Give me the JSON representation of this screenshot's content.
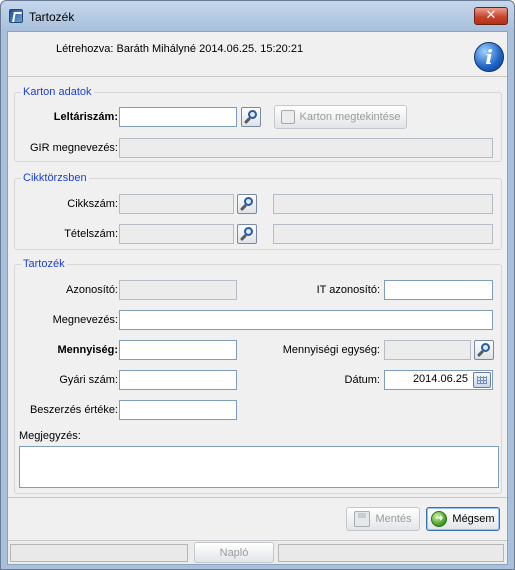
{
  "window": {
    "title": "Tartozék"
  },
  "header": {
    "created_by": "Létrehozva: Baráth Mihályné 2014.06.25. 15:20:21"
  },
  "karton": {
    "legend": "Karton adatok",
    "leltarszam_label": "Leltáriszám:",
    "leltarszam_value": "",
    "view_button": "Karton megtekintése",
    "gir_label": "GIR megnevezés:",
    "gir_value": ""
  },
  "cikk": {
    "legend": "Cikktörzsben",
    "cikkszam_label": "Cikkszám:",
    "cikkszam_value": "",
    "cikkszam_desc": "",
    "tetelszam_label": "Tételszám:",
    "tetelszam_value": "",
    "tetelszam_desc": ""
  },
  "tartozek": {
    "legend": "Tartozék",
    "azonosito_label": "Azonosító:",
    "azonosito_value": "",
    "it_azonosito_label": "IT azonosító:",
    "it_azonosito_value": "",
    "megnevezes_label": "Megnevezés:",
    "megnevezes_value": "",
    "mennyiseg_label": "Mennyiség:",
    "mennyiseg_value": "",
    "mennyisegi_egyseg_label": "Mennyiségi egység:",
    "mennyisegi_egyseg_value": "",
    "gyari_szam_label": "Gyári szám:",
    "gyari_szam_value": "",
    "datum_label": "Dátum:",
    "datum_value": "2014.06.25",
    "beszerzes_label": "Beszerzés értéke:",
    "beszerzes_value": "",
    "megjegyzes_label": "Megjegyzés:",
    "megjegyzes_value": ""
  },
  "footer": {
    "save_button": "Mentés",
    "cancel_button": "Mégsem",
    "log_button": "Napló"
  },
  "icons": {
    "app": "app-icon",
    "close": "close-icon",
    "info": "info-icon",
    "search": "search-icon",
    "calendar": "calendar-icon",
    "save": "save-icon",
    "cancel": "cancel-icon"
  },
  "colors": {
    "legend": "#1c3fd6",
    "window_frame": "#a8c0dc",
    "close_button": "#c7442a"
  }
}
